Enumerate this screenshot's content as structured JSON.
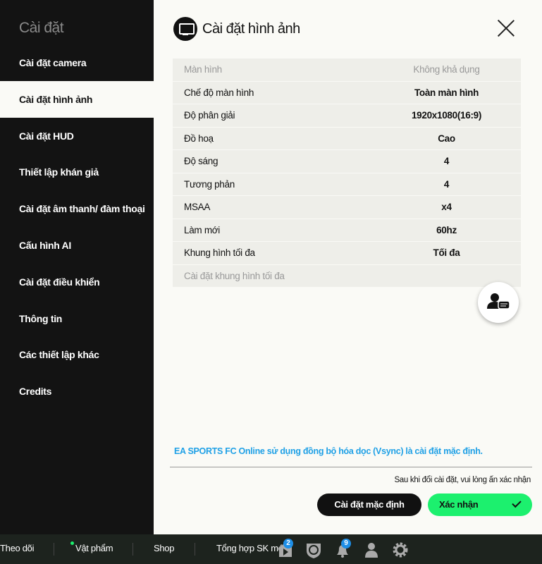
{
  "sidebar": {
    "title": "Cài đặt",
    "items": [
      {
        "label": "Cài đặt camera"
      },
      {
        "label": "Cài đặt hình ảnh",
        "active": true
      },
      {
        "label": "Cài đặt HUD"
      },
      {
        "label": "Thiết lập khán giả"
      },
      {
        "label": "Cài đặt âm thanh/ đàm thoại"
      },
      {
        "label": "Cấu hình AI"
      },
      {
        "label": "Cài đặt điều khiển"
      },
      {
        "label": "Thông tin"
      },
      {
        "label": "Các thiết lập khác"
      },
      {
        "label": "Credits"
      }
    ]
  },
  "header": {
    "title": "Cài đặt hình ảnh",
    "icon": "monitor-icon"
  },
  "settings": [
    {
      "label": "Màn hình",
      "value": "Không khả dụng",
      "disabled": true
    },
    {
      "label": "Chế độ màn hình",
      "value": "Toàn màn hình"
    },
    {
      "label": "Độ phân giải",
      "value": "1920x1080(16:9)"
    },
    {
      "label": "Đồ hoạ",
      "value": "Cao"
    },
    {
      "label": "Độ sáng",
      "value": "4"
    },
    {
      "label": "Tương phản",
      "value": "4"
    },
    {
      "label": "MSAA",
      "value": "x4"
    },
    {
      "label": "Làm mới",
      "value": "60hz"
    },
    {
      "label": "Khung hình tối đa",
      "value": "Tối đa"
    },
    {
      "label": "Cài đặt khung hình tối đa",
      "value": "",
      "disabled": true
    }
  ],
  "footer": {
    "note": "EA SPORTS FC Online sử dụng đồng bộ hóa dọc (Vsync) là cài đặt mặc định.",
    "hint": "Sau khi đổi cài đặt, vui lòng ấn xác nhận",
    "default_button": "Cài đặt mặc định",
    "confirm_button": "Xác nhận"
  },
  "bottom_bar": {
    "items": [
      "Theo dõi",
      "Vật phẩm",
      "Shop",
      "Tổng hợp SK mới"
    ],
    "badges": {
      "events": "2",
      "notifications": "9"
    }
  },
  "colors": {
    "accent": "#1cf06e",
    "note": "#1ea0e6",
    "badge": "#1e8ee6"
  }
}
